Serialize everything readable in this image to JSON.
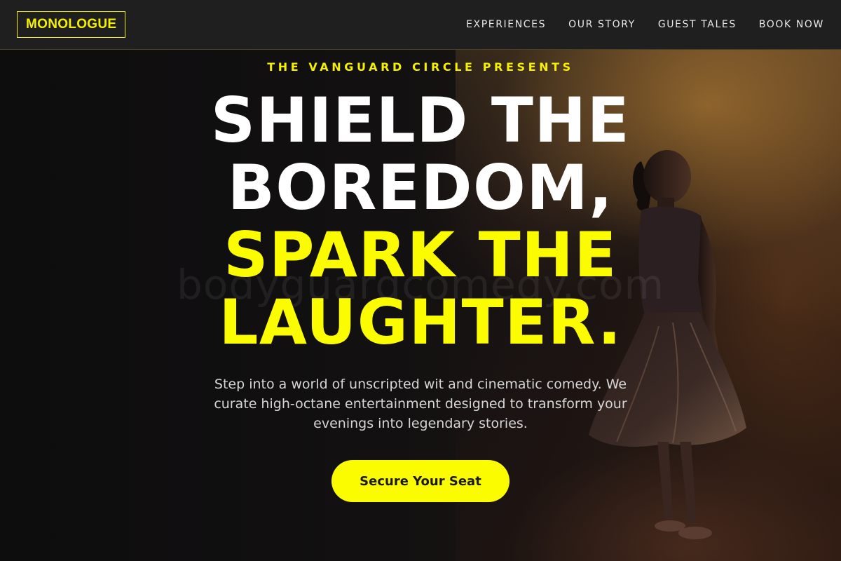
{
  "brand": {
    "logo": "MONOLOGUE",
    "accent": "#fcfc00"
  },
  "nav": {
    "items": [
      {
        "label": "EXPERIENCES"
      },
      {
        "label": "OUR STORY"
      },
      {
        "label": "GUEST TALES"
      },
      {
        "label": "BOOK NOW"
      }
    ]
  },
  "hero": {
    "eyebrow": "THE VANGUARD CIRCLE PRESENTS",
    "headline_lines": [
      {
        "text": "SHIELD THE",
        "color": "white"
      },
      {
        "text": "BOREDOM,",
        "color": "white"
      },
      {
        "text": "SPARK THE",
        "color": "yellow"
      },
      {
        "text": "LAUGHTER.",
        "color": "yellow"
      }
    ],
    "subtext": "Step into a world of unscripted wit and cinematic comedy. We curate high-octane entertainment designed to transform your evenings into legendary stories.",
    "cta_label": "Secure Your Seat",
    "watermark": "bodyguardcomedy.com"
  }
}
